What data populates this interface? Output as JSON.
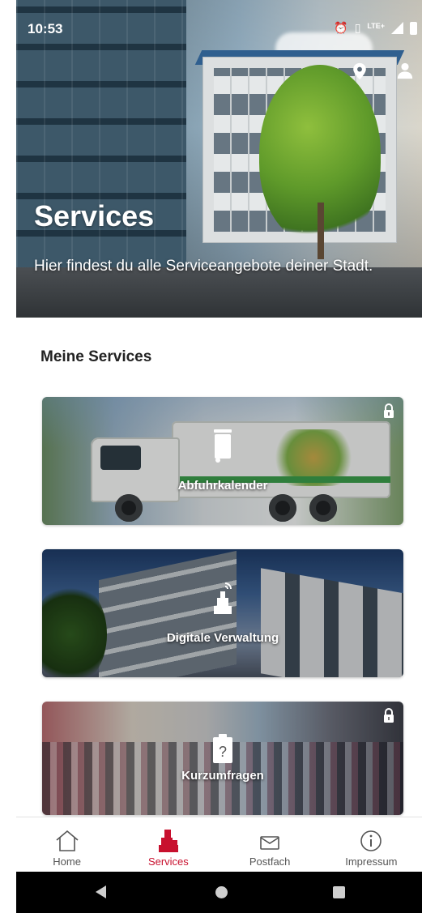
{
  "status_bar": {
    "time": "10:53",
    "network_label": "LTE+"
  },
  "hero": {
    "title": "Services",
    "subtitle": "Hier findest du alle Serviceangebote deiner Stadt."
  },
  "section": {
    "title": "Meine Services"
  },
  "cards": [
    {
      "label": "Abfuhrkalender",
      "icon": "trash-bin-icon",
      "locked": true
    },
    {
      "label": "Digitale Verwaltung",
      "icon": "digital-town-hall-icon",
      "locked": false
    },
    {
      "label": "Kurzumfragen",
      "icon": "clipboard-question-icon",
      "locked": true
    }
  ],
  "bottom_nav": {
    "items": [
      {
        "label": "Home",
        "icon": "home-icon",
        "active": false
      },
      {
        "label": "Services",
        "icon": "services-icon",
        "active": true
      },
      {
        "label": "Postfach",
        "icon": "mail-icon",
        "active": false
      },
      {
        "label": "Impressum",
        "icon": "info-icon",
        "active": false
      }
    ]
  },
  "colors": {
    "accent": "#c8102e",
    "nav_inactive": "#555555",
    "background": "#ffffff"
  }
}
